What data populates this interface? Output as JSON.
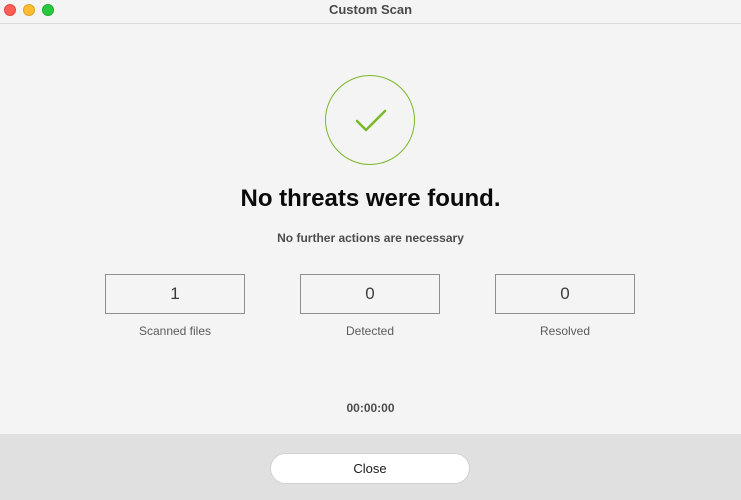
{
  "window": {
    "title": "Custom Scan",
    "controls": {
      "close": {
        "icon": "close-window-icon",
        "color": "#ff5f57"
      },
      "minimize": {
        "icon": "minimize-window-icon",
        "color": "#febc2e"
      },
      "maximize": {
        "icon": "maximize-window-icon",
        "color": "#28c840"
      }
    }
  },
  "result": {
    "icon": "checkmark-icon",
    "accent_color": "#7ab829",
    "headline": "No threats were found.",
    "subline": "No further actions are necessary"
  },
  "stats": [
    {
      "value": "1",
      "label": "Scanned files"
    },
    {
      "value": "0",
      "label": "Detected"
    },
    {
      "value": "0",
      "label": "Resolved"
    }
  ],
  "elapsed_time": "00:00:00",
  "footer": {
    "close_label": "Close"
  }
}
